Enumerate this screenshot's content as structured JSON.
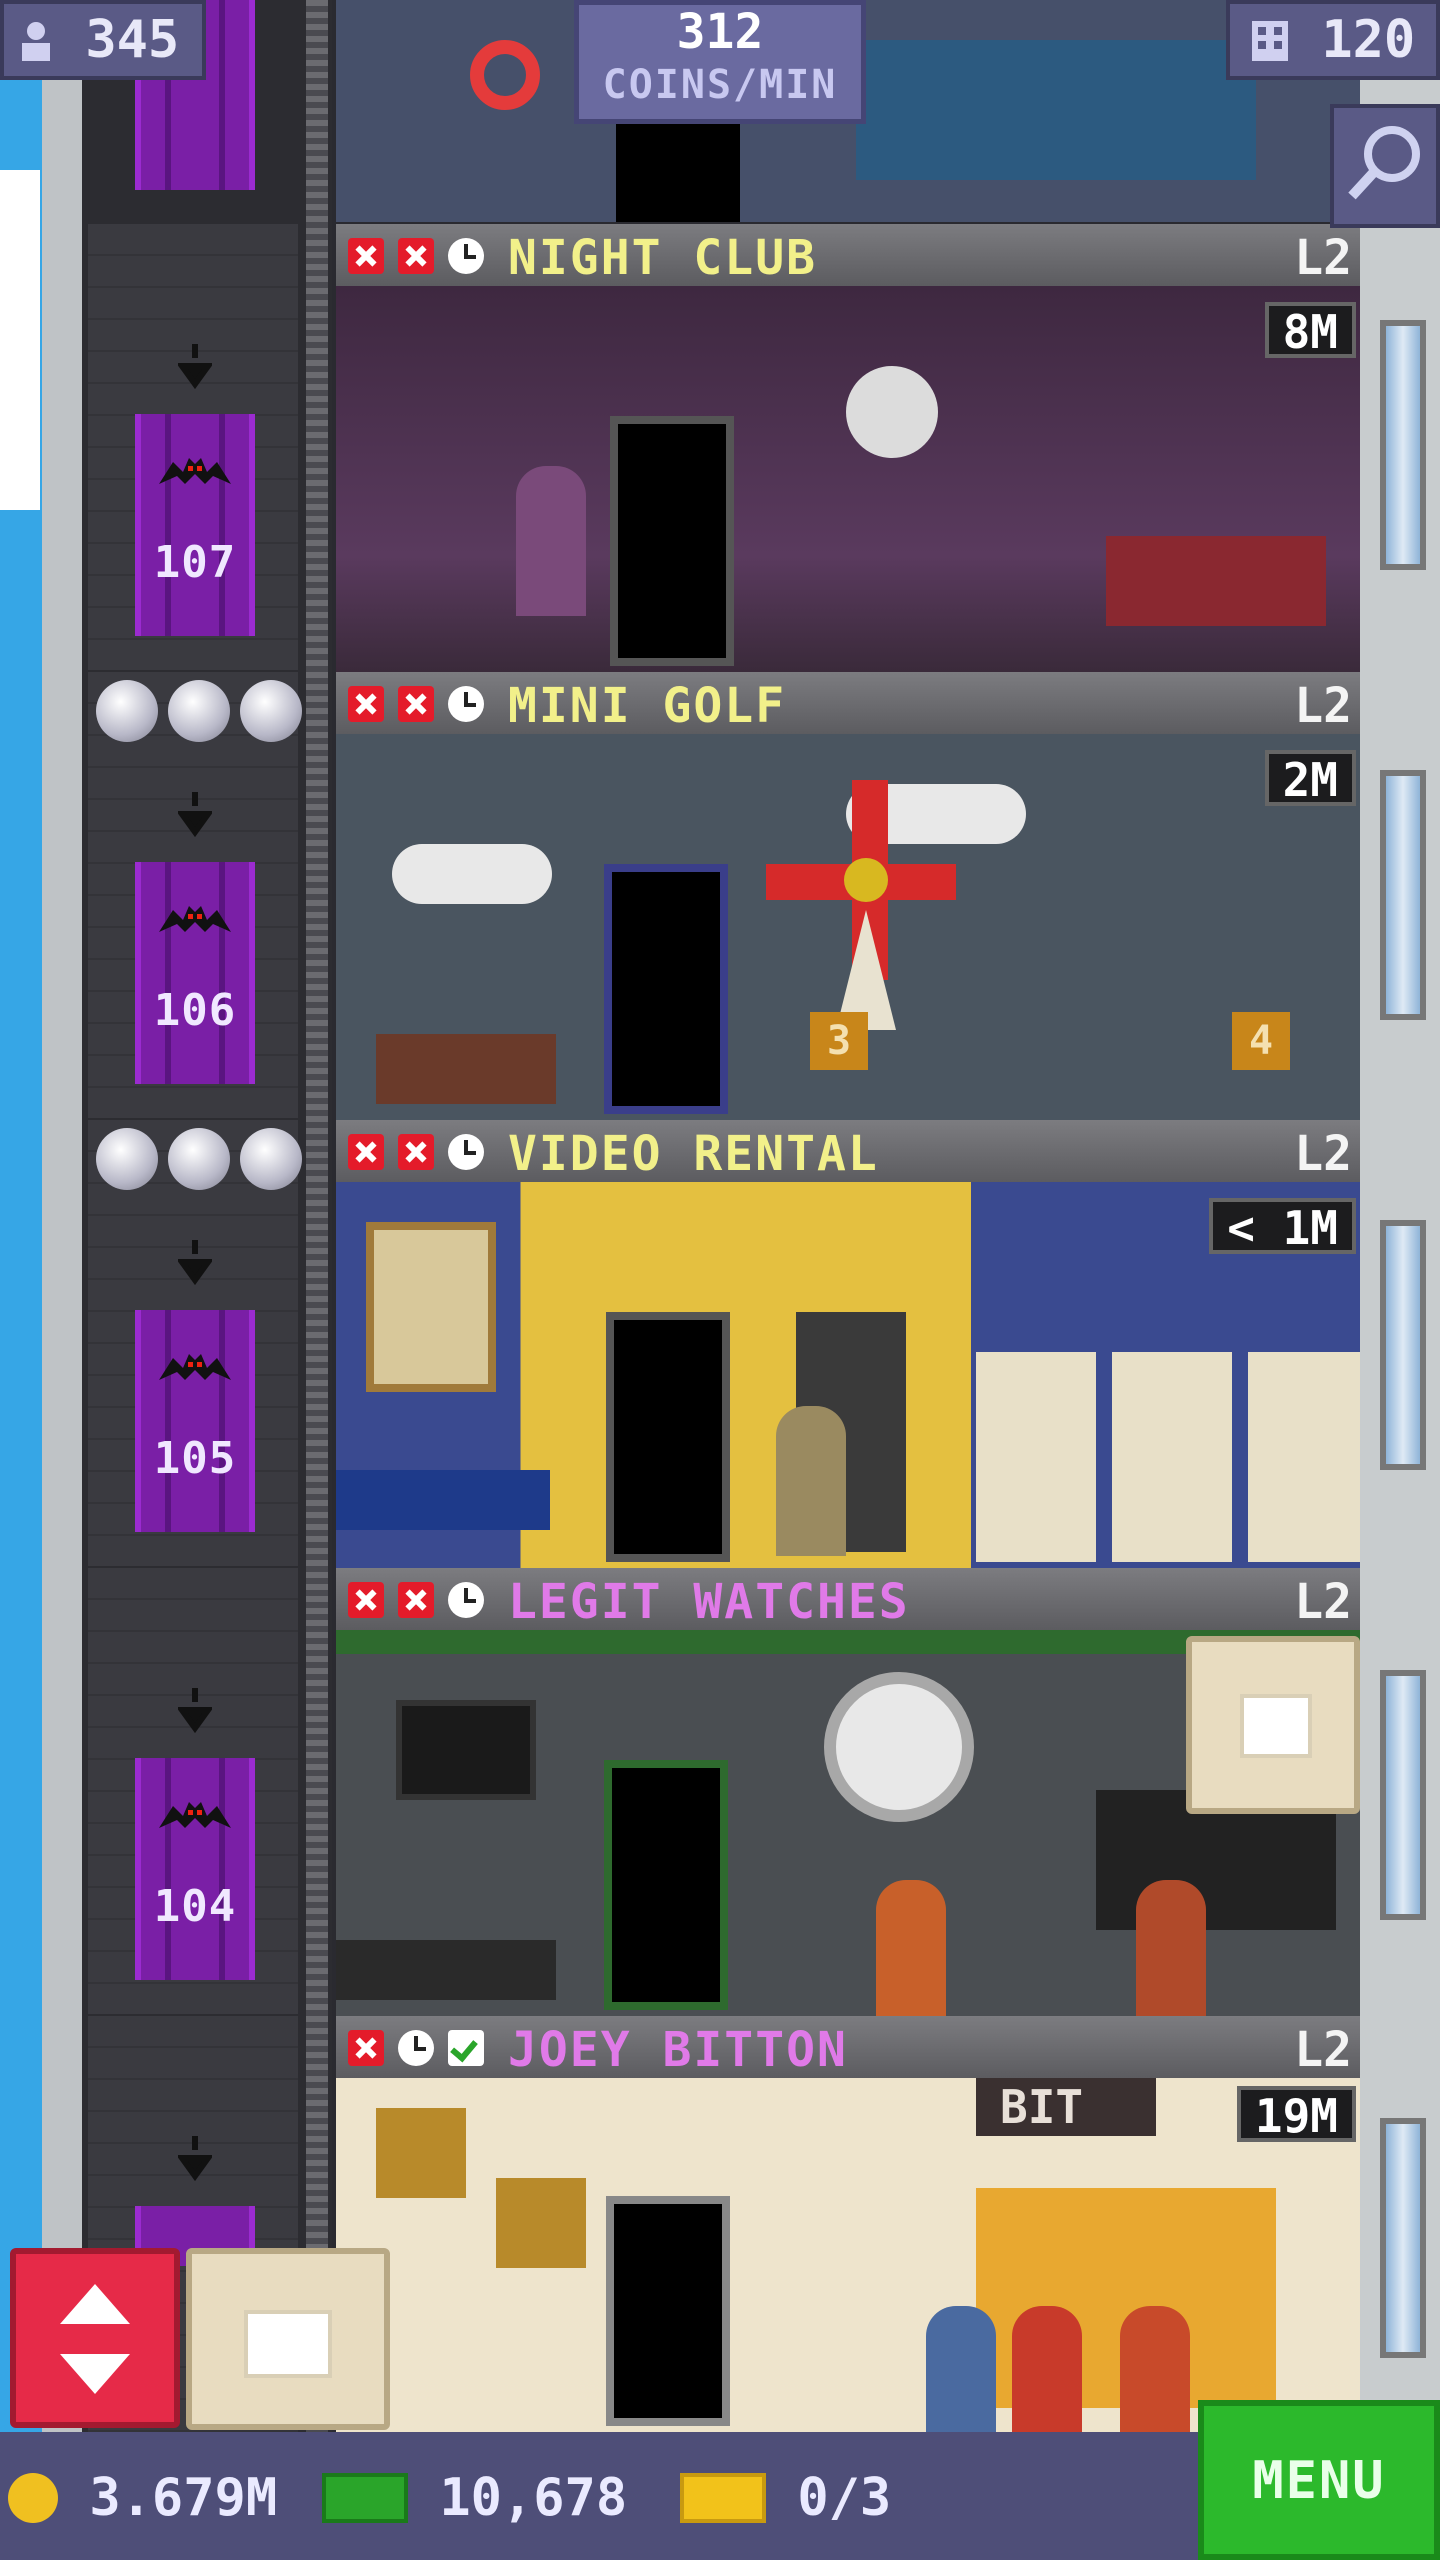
{
  "top_bar": {
    "population": "345",
    "coins_rate_value": "312",
    "coins_rate_label": "COINS/MIN",
    "floors_count": "120"
  },
  "elevator": {
    "floor_numbers": [
      "107",
      "106",
      "105",
      "104"
    ]
  },
  "floors": [
    {
      "name": "NIGHT CLUB",
      "level": "L2",
      "timer": "8M",
      "name_color": "#f2f08a",
      "icons": [
        "x",
        "x",
        "clock"
      ]
    },
    {
      "name": "MINI GOLF",
      "level": "L2",
      "timer": "2M",
      "name_color": "#f2f08a",
      "icons": [
        "x",
        "x",
        "clock"
      ]
    },
    {
      "name": "VIDEO RENTAL",
      "level": "L2",
      "timer": "< 1M",
      "name_color": "#f2f08a",
      "icons": [
        "x",
        "x",
        "clock"
      ]
    },
    {
      "name": "LEGIT WATCHES",
      "level": "L2",
      "timer": "",
      "name_color": "#e07ae8",
      "icons": [
        "x",
        "x",
        "clock"
      ]
    },
    {
      "name": "JOEY BITTON",
      "level": "L2",
      "timer": "19M",
      "name_color": "#e07ae8",
      "icons": [
        "x",
        "clock",
        "check"
      ]
    }
  ],
  "floor_props": {
    "minigolf_hole_a": "3",
    "minigolf_hole_b": "4",
    "bitton_sign": "BIT"
  },
  "bottom_bar": {
    "coins": "3.679M",
    "bux": "10,678",
    "tickets": "0/3",
    "menu_label": "MENU"
  },
  "colors": {
    "elevator_door": "#7a1fa6",
    "coin": "#f0c020",
    "bux": "#2aa52a",
    "ticket": "#f2c21a",
    "menu_bg": "#2cb92c"
  }
}
